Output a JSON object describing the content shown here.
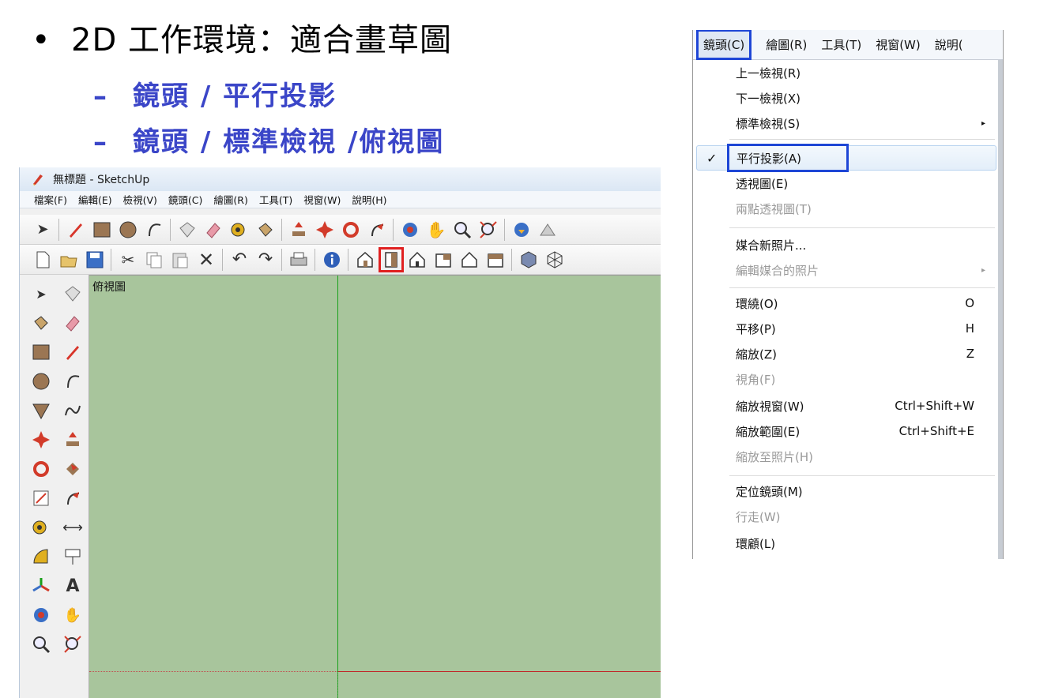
{
  "slide": {
    "bullet_main": "2D 工作環境：適合畫草圖",
    "bullet_dot": "•",
    "sub_bullets": [
      {
        "dash": "–",
        "text": "鏡頭 / 平行投影"
      },
      {
        "dash": "–",
        "text": "鏡頭 / 標準檢視 /俯視圖"
      }
    ]
  },
  "sketchup": {
    "window_title": "無標題 - SketchUp",
    "menubar": [
      "檔案(F)",
      "編輯(E)",
      "檢視(V)",
      "鏡頭(C)",
      "繪圖(R)",
      "工具(T)",
      "視窗(W)",
      "說明(H)"
    ],
    "toolbar1_icons": [
      "select-icon",
      "pencil-icon",
      "rectangle-icon",
      "circle-icon",
      "arc-icon",
      "make-component-icon",
      "eraser-icon",
      "tape-measure-icon",
      "paint-bucket-icon",
      "push-pull-icon",
      "move-icon",
      "rotate-icon",
      "follow-me-icon",
      "orbit-icon",
      "pan-icon",
      "zoom-icon",
      "zoom-extents-icon",
      "get-models-icon",
      "share-model-icon"
    ],
    "toolbar2_icons": [
      "new-icon",
      "open-icon",
      "save-icon",
      "cut-icon",
      "copy-icon",
      "paste-icon",
      "delete-icon",
      "undo-icon",
      "redo-icon",
      "print-icon",
      "model-info-icon",
      "iso-view-icon",
      "top-view-icon",
      "front-view-icon",
      "right-view-icon",
      "back-view-icon",
      "left-view-icon",
      "xray-icon",
      "wireframe-icon"
    ],
    "highlighted_view_icon": "top-view-icon",
    "viewport_label": "俯視圖",
    "viewport_color": "#a8c59c"
  },
  "camera_menu": {
    "top_menus": [
      "鏡頭(C)",
      "繪圖(R)",
      "工具(T)",
      "視窗(W)",
      "說明("
    ],
    "active_top_menu": "鏡頭(C)",
    "items": [
      {
        "label": "上一檢視(R)",
        "shortcut": "",
        "enabled": true
      },
      {
        "label": "下一檢視(X)",
        "shortcut": "",
        "enabled": true
      },
      {
        "label": "標準檢視(S)",
        "shortcut": "",
        "enabled": true,
        "submenu": true
      },
      {
        "label": "平行投影(A)",
        "shortcut": "",
        "enabled": true,
        "checked": true
      },
      {
        "label": "透視圖(E)",
        "shortcut": "",
        "enabled": true
      },
      {
        "label": "兩點透視圖(T)",
        "shortcut": "",
        "enabled": false
      },
      {
        "label": "媒合新照片...",
        "shortcut": "",
        "enabled": true
      },
      {
        "label": "編輯媒合的照片",
        "shortcut": "",
        "enabled": false,
        "submenu": true
      },
      {
        "label": "環繞(O)",
        "shortcut": "O",
        "enabled": true
      },
      {
        "label": "平移(P)",
        "shortcut": "H",
        "enabled": true
      },
      {
        "label": "縮放(Z)",
        "shortcut": "Z",
        "enabled": true
      },
      {
        "label": "視角(F)",
        "shortcut": "",
        "enabled": false
      },
      {
        "label": "縮放視窗(W)",
        "shortcut": "Ctrl+Shift+W",
        "enabled": true
      },
      {
        "label": "縮放範圍(E)",
        "shortcut": "Ctrl+Shift+E",
        "enabled": true
      },
      {
        "label": "縮放至照片(H)",
        "shortcut": "",
        "enabled": false
      },
      {
        "label": "定位鏡頭(M)",
        "shortcut": "",
        "enabled": true
      },
      {
        "label": "行走(W)",
        "shortcut": "",
        "enabled": false
      },
      {
        "label": "環顧(L)",
        "shortcut": "",
        "enabled": true
      }
    ],
    "check_glyph": "✓",
    "submenu_glyph": "▸",
    "highlight_color": "#1e46d6"
  }
}
